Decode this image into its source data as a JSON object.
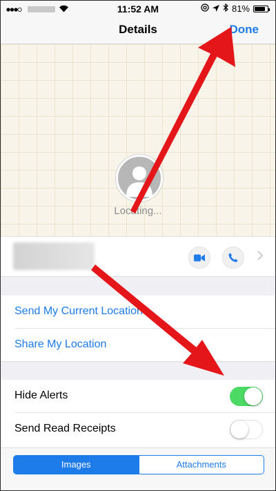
{
  "status_bar": {
    "time": "11:52 AM",
    "battery_percent": "81%",
    "battery_level": 0.81,
    "icons": [
      "signal-icon",
      "wifi-icon",
      "at-icon",
      "location-arrow-icon",
      "bluetooth-icon",
      "battery-icon"
    ]
  },
  "nav": {
    "title": "Details",
    "done_label": "Done"
  },
  "map": {
    "status_text": "Locating..."
  },
  "contact": {
    "actions": [
      "video-call-icon",
      "phone-icon",
      "chevron-right-icon"
    ]
  },
  "location_section": {
    "send_current": "Send My Current Location",
    "share": "Share My Location"
  },
  "settings": {
    "hide_alerts": {
      "label": "Hide Alerts",
      "on": true
    },
    "read_receipts": {
      "label": "Send Read Receipts",
      "on": false
    }
  },
  "segment": {
    "tabs": [
      "Images",
      "Attachments"
    ],
    "selected": "Images"
  },
  "colors": {
    "accent": "#1d7bea",
    "toggle_on": "#4cd964",
    "annotation_arrow": "#e5161a"
  }
}
